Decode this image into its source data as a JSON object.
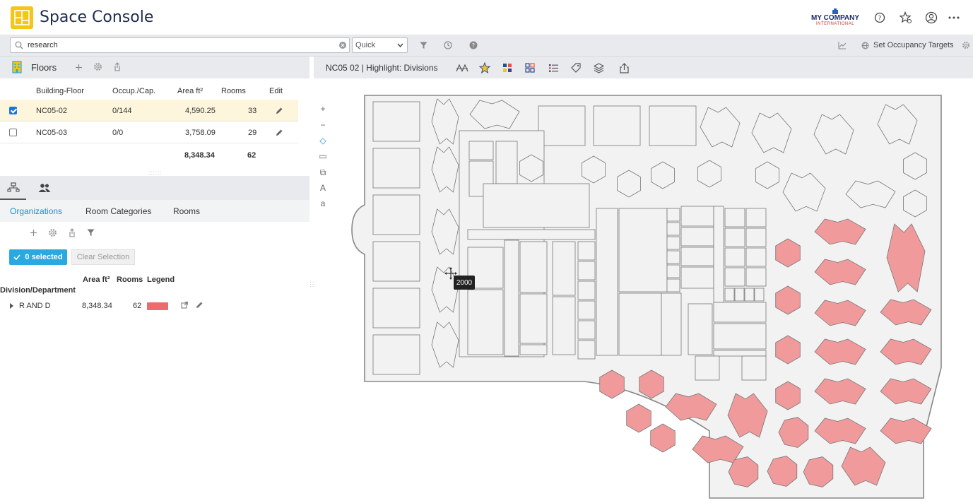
{
  "app": {
    "title": "Space Console",
    "company_name": "MY COMPANY",
    "company_sub": "INTERNATIONAL"
  },
  "header_icons": [
    "help-circle-icon",
    "star-settings-icon",
    "user-account-icon",
    "more-horizontal-icon"
  ],
  "search": {
    "value": "research",
    "placeholder": "",
    "mode": "Quick"
  },
  "toolbar": {
    "set_occupancy_label": "Set Occupancy Targets"
  },
  "floors": {
    "title": "Floors",
    "columns": [
      "Building-Floor",
      "Occup./Cap.",
      "Area ft²",
      "Rooms",
      "Edit"
    ],
    "rows": [
      {
        "floor": "NC05-02",
        "occupancy": "0/144",
        "area": "4,590.25",
        "rooms": "33",
        "checked": true
      },
      {
        "floor": "NC05-03",
        "occupancy": "0/0",
        "area": "3,758.09",
        "rooms": "29",
        "checked": false
      }
    ],
    "total_area": "8,348.34",
    "total_rooms": "62"
  },
  "lower_tabs": {
    "subtabs": [
      "Organizations",
      "Room Categories",
      "Rooms"
    ],
    "active": "Organizations"
  },
  "selection": {
    "selected_label": "0 selected",
    "clear_label": "Clear Selection"
  },
  "divisions": {
    "headers": {
      "name": "Division/Department",
      "area": "Area ft²",
      "rooms": "Rooms",
      "legend": "Legend"
    },
    "rows": [
      {
        "name": "R AND D",
        "area": "8,348.34",
        "rooms": "62",
        "color": "#ec6b6e"
      }
    ]
  },
  "map": {
    "title": "NC05 02 | Highlight: Divisions",
    "tooltip": "2000",
    "zoom_controls": [
      "+",
      "−",
      "◇",
      "▭",
      "⧉",
      "A",
      "a"
    ],
    "highlight_color": "#f09a9c",
    "room_color": "#f2f2f2"
  },
  "colors": {
    "accent": "#29a9e0",
    "brand": "#f5c518",
    "title": "#1f2d4d",
    "panel_bg": "#e8eaee"
  }
}
